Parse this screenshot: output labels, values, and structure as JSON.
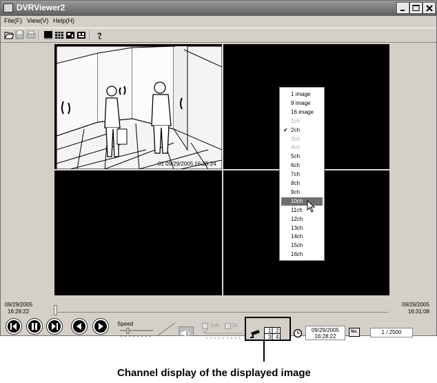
{
  "window": {
    "title": "DVRViewer2"
  },
  "menubar": {
    "file": "File(F)",
    "view": "View(V)",
    "help": "Help(H)"
  },
  "camera": {
    "timestamp": "01  09/29/2005 16:28:24"
  },
  "context_menu": {
    "items": [
      {
        "label": "1 image",
        "state": "normal"
      },
      {
        "label": "9 image",
        "state": "normal"
      },
      {
        "label": "16 image",
        "state": "normal"
      },
      {
        "label": "1ch",
        "state": "disabled"
      },
      {
        "label": "2ch",
        "state": "checked"
      },
      {
        "label": "3ch",
        "state": "disabled"
      },
      {
        "label": "4ch",
        "state": "disabled"
      },
      {
        "label": "5ch",
        "state": "normal"
      },
      {
        "label": "6ch",
        "state": "normal"
      },
      {
        "label": "7ch",
        "state": "normal"
      },
      {
        "label": "8ch",
        "state": "normal"
      },
      {
        "label": "9ch",
        "state": "normal"
      },
      {
        "label": "10ch",
        "state": "selected"
      },
      {
        "label": "11ch",
        "state": "normal"
      },
      {
        "label": "12ch",
        "state": "normal"
      },
      {
        "label": "13ch",
        "state": "normal"
      },
      {
        "label": "14ch",
        "state": "normal"
      },
      {
        "label": "15ch",
        "state": "normal"
      },
      {
        "label": "16ch",
        "state": "normal"
      }
    ]
  },
  "timeline": {
    "start_date": "09/29/2005",
    "start_time": "16:28:22",
    "end_date": "09/29/2005",
    "end_time": "16:31:08"
  },
  "controls": {
    "speed_label": "Speed",
    "audio_ch1": "1ch",
    "audio_ch2": "2c",
    "channels": [
      "1",
      "2",
      "3",
      "4"
    ],
    "current_date": "09/29/2005",
    "current_time": "16:28:22",
    "frame_counter": "1 / 2500",
    "no_label": "No."
  },
  "caption": "Channel display of the displayed image"
}
